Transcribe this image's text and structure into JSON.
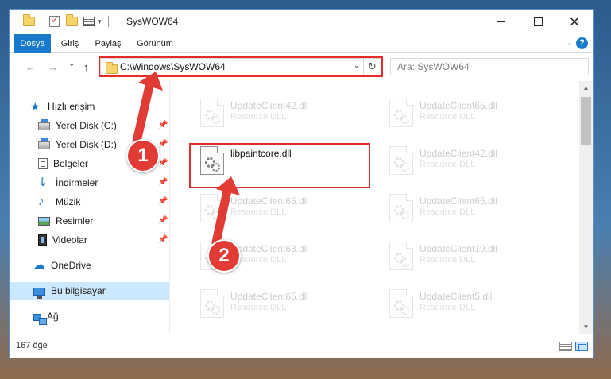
{
  "window": {
    "title": "SysWOW64",
    "controls": {
      "minimize": "minimize",
      "maximize": "maximize",
      "close": "✕"
    }
  },
  "ribbon": {
    "tabs": [
      "Dosya",
      "Giriş",
      "Paylaş",
      "Görünüm"
    ],
    "active_tab": "Dosya",
    "help": "?"
  },
  "navigation": {
    "back": "←",
    "forward": "→",
    "recent": "⌄",
    "up": "↑",
    "address": "C:\\Windows\\SysWOW64",
    "refresh": "↻",
    "search_placeholder": "Ara: SysWOW64"
  },
  "sidebar": {
    "items": [
      {
        "label": "Hızlı erişim",
        "icon": "star-icon"
      },
      {
        "label": "Yerel Disk (C:)",
        "icon": "drive-icon",
        "pinned": true
      },
      {
        "label": "Yerel Disk (D:)",
        "icon": "drive-icon",
        "pinned": true
      },
      {
        "label": "Belgeler",
        "icon": "documents-icon",
        "pinned": true
      },
      {
        "label": "İndirmeler",
        "icon": "download-icon",
        "pinned": true
      },
      {
        "label": "Müzik",
        "icon": "music-icon",
        "pinned": true
      },
      {
        "label": "Resimler",
        "icon": "pictures-icon",
        "pinned": true
      },
      {
        "label": "Videolar",
        "icon": "videos-icon",
        "pinned": true
      },
      {
        "label": "OneDrive",
        "icon": "cloud-icon"
      },
      {
        "label": "Bu bilgisayar",
        "icon": "computer-icon",
        "selected": true
      },
      {
        "label": "Ağ",
        "icon": "network-icon"
      }
    ]
  },
  "files": {
    "highlighted": {
      "name": "libpaintcore.dll"
    },
    "faded": [
      {
        "name": "UpdateClient42.dll",
        "type": "Resource DLL"
      },
      {
        "name": "UpdateClient65.dll",
        "type": "Resource DLL"
      },
      {
        "name": "UpdateClient42.dll",
        "type": "Resource DLL"
      },
      {
        "name": "UpdateClient65.dll",
        "type": "Resource DLL"
      },
      {
        "name": "UpdateClient65.dll",
        "type": "Resource DLL"
      },
      {
        "name": "UpdateClient63.dll",
        "type": "Resource DLL"
      },
      {
        "name": "UpdateClient19.dll",
        "type": "Resource DLL"
      },
      {
        "name": "UpdateClient65.dll",
        "type": "Resource DLL"
      },
      {
        "name": "UpdateClient5.dll",
        "type": "Resource DLL"
      }
    ]
  },
  "status": {
    "item_count": "167 öğe"
  },
  "annotations": {
    "step1": "1",
    "step2": "2",
    "color": "#e52a2a"
  }
}
